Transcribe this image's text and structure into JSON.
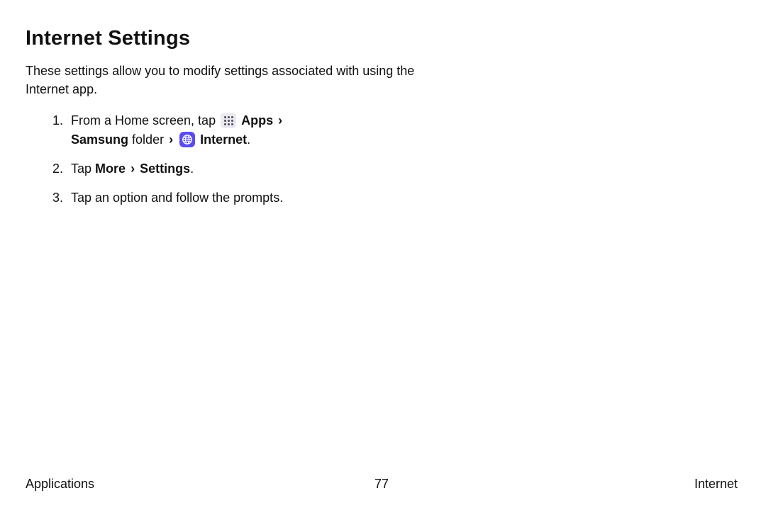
{
  "title": "Internet Settings",
  "intro": "These settings allow you to modify settings associated with using the Internet app.",
  "steps": {
    "s1": {
      "pre": "From a Home screen, tap ",
      "apps": "Apps",
      "samsung": "Samsung",
      "folder": " folder ",
      "internet": "Internet",
      "period": "."
    },
    "s2": {
      "pre": "Tap ",
      "more": "More",
      "settings": "Settings",
      "period": "."
    },
    "s3": "Tap an option and follow the prompts."
  },
  "footer": {
    "left": "Applications",
    "center": "77",
    "right": "Internet"
  },
  "glyphs": {
    "chevron": "›"
  }
}
